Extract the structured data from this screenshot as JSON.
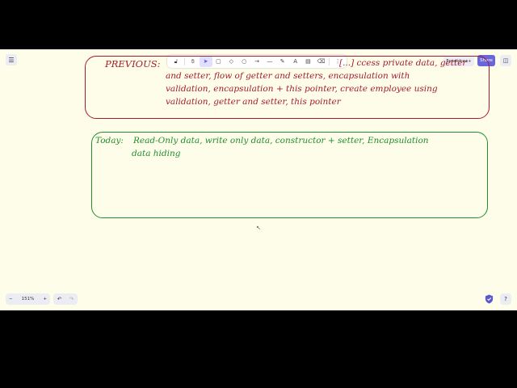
{
  "toolbar": {
    "menu_icon": "☰",
    "tools": [
      {
        "name": "lock-icon",
        "glyph": "🔓︎"
      },
      {
        "name": "hand-icon",
        "glyph": "✋︎"
      },
      {
        "name": "pointer-icon",
        "glyph": "➤"
      },
      {
        "name": "rectangle-icon",
        "glyph": "▢"
      },
      {
        "name": "diamond-icon",
        "glyph": "◇"
      },
      {
        "name": "ellipse-icon",
        "glyph": "○"
      },
      {
        "name": "arrow-icon",
        "glyph": "→"
      },
      {
        "name": "line-icon",
        "glyph": "—"
      },
      {
        "name": "pencil-icon",
        "glyph": "✎"
      },
      {
        "name": "text-icon",
        "glyph": "A"
      },
      {
        "name": "image-icon",
        "glyph": "▤"
      },
      {
        "name": "eraser-icon",
        "glyph": "⌫"
      },
      {
        "name": "more-tools-icon",
        "glyph": "⋮"
      }
    ]
  },
  "header": {
    "library_label": "Excalidraw+",
    "share_label": "Share",
    "sidebar_icon": "◫"
  },
  "canvas": {
    "previous": {
      "heading": "PREVIOUS:",
      "lines": [
        "[...] ccess private data, getter",
        "and setter, flow of getter and setters, encapsulation with",
        "validation, encapsulation + this pointer, create employee using",
        "validation, getter and setter, this pointer"
      ]
    },
    "today": {
      "heading": "Today:",
      "lines": [
        "Read-Only data, write only data, constructor + setter, Encapsulation",
        "data hiding"
      ]
    }
  },
  "footer": {
    "zoom_out": "−",
    "zoom_level": "151%",
    "zoom_in": "+",
    "undo": "↶",
    "redo": "↷",
    "help": "?"
  },
  "colors": {
    "previous": "#a61c2a",
    "today": "#1e8f2c",
    "accent": "#6965db",
    "canvas_bg": "#fefde9"
  }
}
